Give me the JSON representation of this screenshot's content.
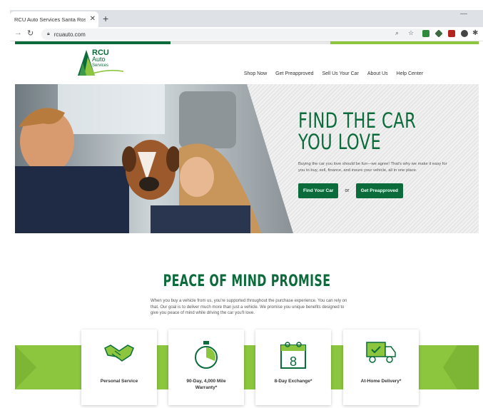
{
  "browser": {
    "tab_title": "RCU Auto Services Santa Rosa Ca",
    "url": "rcuauto.com",
    "new_tab": "+",
    "close": "✕"
  },
  "colors": {
    "brand_green": "#0b6b3a",
    "accent_green": "#8cc63f"
  },
  "site": {
    "logo": {
      "line1": "RCU",
      "line2": "Auto",
      "line3": "Services"
    },
    "nav": [
      "Shop Now",
      "Get Preapproved",
      "Sell Us Your Car",
      "About Us",
      "Help Center"
    ]
  },
  "hero": {
    "title_line1": "FIND THE CAR",
    "title_line2": "YOU LOVE",
    "description": "Buying the car you love should be fun—we agree! That's why we make it easy for you to buy, sell, finance, and insure your vehicle, all in one place.",
    "primary_button": "Find Your Car",
    "or_text": "or",
    "secondary_button": "Get Preapproved"
  },
  "promise": {
    "title": "PEACE OF MIND PROMISE",
    "text": "When you buy a vehicle from us, you're supported throughout the purchase experience. You can rely on that. Our goal is to deliver much more than just a vehicle. We promise you unique benefits designed to give you peace of mind while driving the car you'll love.",
    "cards": [
      {
        "label": "Personal Service",
        "icon": "handshake-icon"
      },
      {
        "label": "90-Day, 4,000 Mile Warranty*",
        "icon": "stopwatch-icon"
      },
      {
        "label": "8-Day Exchange*",
        "icon": "calendar-icon"
      },
      {
        "label": "At-Home Delivery*",
        "icon": "delivery-truck-icon"
      }
    ]
  }
}
